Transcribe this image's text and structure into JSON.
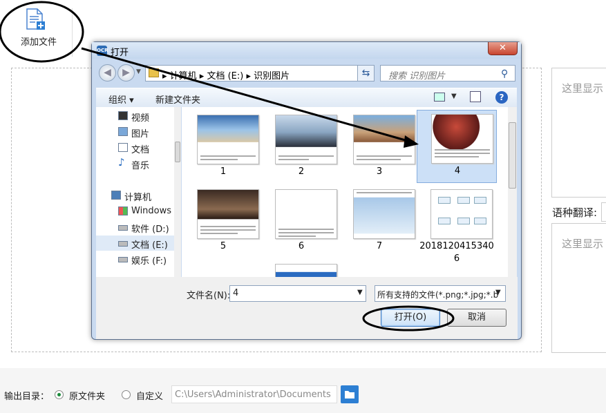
{
  "toolbar": {
    "add_file_label": "添加文件"
  },
  "right_panel": {
    "placeholder_top": "这里显示",
    "language_label": "语种翻译:",
    "placeholder_bottom": "这里显示"
  },
  "footer": {
    "output_dir_label": "输出目录：",
    "option_original": "原文件夹",
    "option_custom": "自定义",
    "path_value": "C:\\Users\\Administrator\\Documents"
  },
  "dialog": {
    "title": "打开",
    "close_glyph": "✕",
    "breadcrumb": "▸ 计算机 ▸ 文档 (E:) ▸ 识别图片",
    "search_placeholder": "搜索 识别图片",
    "organize_label": "组织 ▾",
    "new_folder_label": "新建文件夹",
    "nav_items": [
      {
        "label": "视频",
        "icon": "video-icon"
      },
      {
        "label": "图片",
        "icon": "pictures-icon"
      },
      {
        "label": "文档",
        "icon": "documents-icon"
      },
      {
        "label": "音乐",
        "icon": "music-icon"
      },
      {
        "label": "计算机",
        "icon": "computer-icon"
      },
      {
        "label": "Windows",
        "icon": "windows-drive-icon"
      },
      {
        "label": "软件 (D:)",
        "icon": "drive-icon"
      },
      {
        "label": "文档 (E:)",
        "icon": "drive-icon"
      },
      {
        "label": "娱乐 (F:)",
        "icon": "drive-icon"
      }
    ],
    "files": [
      {
        "name": "1"
      },
      {
        "name": "2"
      },
      {
        "name": "3"
      },
      {
        "name": "4"
      },
      {
        "name": "5"
      },
      {
        "name": "6"
      },
      {
        "name": "7"
      },
      {
        "name": "2018120415340\n6"
      }
    ],
    "file_name_label": "文件名(N):",
    "file_name_value": "4",
    "filter_value": "所有支持的文件(*.png;*.jpg;*.b",
    "open_label": "打开(O)",
    "cancel_label": "取消"
  }
}
